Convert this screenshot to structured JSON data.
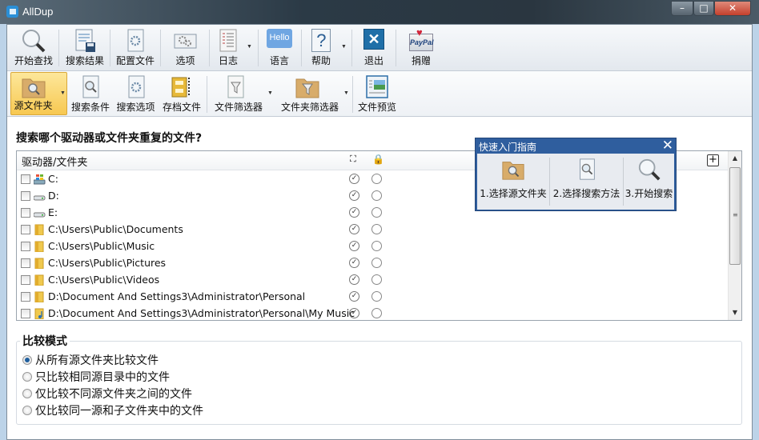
{
  "window": {
    "title": "AllDup",
    "controls": [
      "minimize",
      "maximize",
      "close"
    ]
  },
  "toolbar_main": [
    {
      "label": "开始查找",
      "icon": "magnifier-icon"
    },
    {
      "label": "搜索结果",
      "icon": "results-icon"
    },
    {
      "label": "配置文件",
      "icon": "profile-icon"
    },
    {
      "label": "选项",
      "icon": "options-icon"
    },
    {
      "label": "日志",
      "icon": "log-icon",
      "dropdown": true
    },
    {
      "label": "语言",
      "icon": "hello-bubble-icon",
      "badge": "Hello"
    },
    {
      "label": "帮助",
      "icon": "help-icon",
      "dropdown": true
    },
    {
      "label": "退出",
      "icon": "exit-icon"
    },
    {
      "label": "捐赠",
      "icon": "paypal-icon",
      "badge": "PayPal"
    }
  ],
  "toolbar_sub": [
    {
      "label": "源文件夹",
      "icon": "folder-search-icon",
      "dropdown": true,
      "active": true
    },
    {
      "label": "搜索条件",
      "icon": "search-criteria-icon"
    },
    {
      "label": "搜索选项",
      "icon": "search-options-icon"
    },
    {
      "label": "存档文件",
      "icon": "archive-icon"
    },
    {
      "label": "文件筛选器",
      "icon": "file-filter-icon",
      "dropdown": true
    },
    {
      "label": "文件夹筛选器",
      "icon": "folder-filter-icon",
      "dropdown": true
    },
    {
      "label": "文件预览",
      "icon": "file-preview-icon"
    }
  ],
  "main": {
    "heading": "搜索哪个驱动器或文件夹重复的文件?",
    "list": {
      "column_header": "驱动器/文件夹",
      "rows": [
        {
          "path": "C:",
          "type": "system-drive"
        },
        {
          "path": "D:",
          "type": "drive"
        },
        {
          "path": "E:",
          "type": "drive"
        },
        {
          "path": "C:\\Users\\Public\\Documents",
          "type": "folder"
        },
        {
          "path": "C:\\Users\\Public\\Music",
          "type": "folder"
        },
        {
          "path": "C:\\Users\\Public\\Pictures",
          "type": "folder"
        },
        {
          "path": "C:\\Users\\Public\\Videos",
          "type": "folder"
        },
        {
          "path": "D:\\Document And Settings3\\Administrator\\Personal",
          "type": "folder"
        },
        {
          "path": "D:\\Document And Settings3\\Administrator\\Personal\\My Music",
          "type": "music-folder"
        }
      ]
    },
    "quick_guide": {
      "title": "快速入门指南",
      "steps": [
        "1.选择源文件夹",
        "2.选择搜索方法",
        "3.开始搜索"
      ]
    },
    "compare_mode": {
      "title": "比较模式",
      "options": [
        "从所有源文件夹比较文件",
        "只比较相同源目录中的文件",
        "仅比较不同源文件夹之间的文件",
        "仅比较同一源和子文件夹中的文件"
      ],
      "selected": 0
    }
  }
}
